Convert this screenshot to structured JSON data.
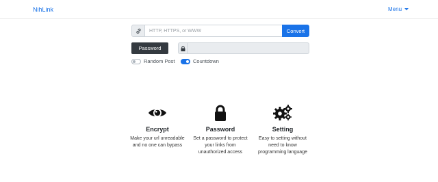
{
  "nav": {
    "brand": "NihLink",
    "menu_label": "Menu"
  },
  "url_form": {
    "placeholder": "HTTP, HTTPS, or WWW",
    "value": "",
    "convert_label": "Convert"
  },
  "password": {
    "button_label": "Password",
    "value": ""
  },
  "options": {
    "random_post": {
      "label": "Random Post",
      "enabled": false
    },
    "countdown": {
      "label": "Countdown",
      "enabled": true
    }
  },
  "features": [
    {
      "icon": "eye-icon",
      "title": "Encrypt",
      "description": "Make your url unreadable and no one can bypass"
    },
    {
      "icon": "lock-icon",
      "title": "Password",
      "description": "Set a password to protect your links from unauthorized access"
    },
    {
      "icon": "gears-icon",
      "title": "Setting",
      "description": "Easy to setting without need to know programming language"
    }
  ],
  "colors": {
    "accent": "#1a73e8",
    "dark_button": "#343a40",
    "addon_bg": "#e9ecef"
  }
}
